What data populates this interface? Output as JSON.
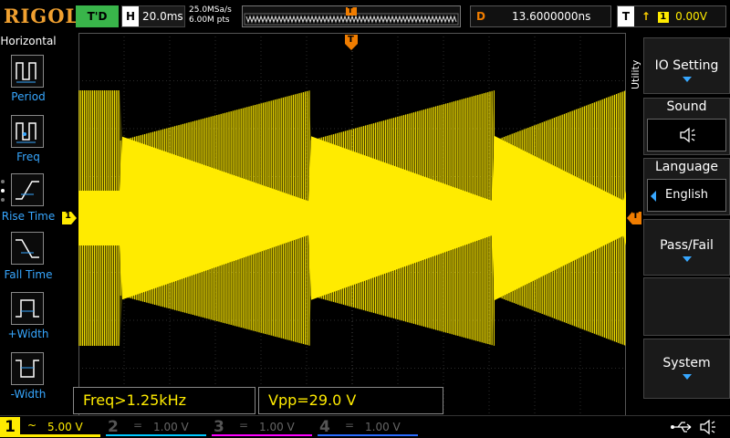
{
  "header": {
    "brand": "RIGOL",
    "run_status": "T'D",
    "horizontal": {
      "label": "H",
      "value": "20.0ms"
    },
    "sample_rate": "25.0MSa/s",
    "memory_depth": "6.00M pts",
    "delay": {
      "label": "D",
      "value": "13.6000000ns"
    },
    "trigger": {
      "label": "T",
      "source": "1",
      "level": "0.00V"
    },
    "memory_marker": "T"
  },
  "left_panel": {
    "title": "Horizontal",
    "items": [
      {
        "label": "Period"
      },
      {
        "label": "Freq"
      },
      {
        "label": "Rise Time"
      },
      {
        "label": "Fall Time"
      },
      {
        "label": "+Width"
      },
      {
        "label": "-Width"
      }
    ]
  },
  "right_panel": {
    "title": "Utility",
    "items": [
      {
        "label": "IO Setting"
      },
      {
        "label": "Sound"
      },
      {
        "label": "Language",
        "value": "English"
      },
      {
        "label": "Pass/Fail"
      },
      {
        "label": "System"
      }
    ]
  },
  "markers": {
    "trigger_top": "T",
    "ch1_ground": "1",
    "trigger_level": "T"
  },
  "measurements": [
    {
      "text": "Freq>1.25kHz"
    },
    {
      "text": "Vpp=29.0 V"
    }
  ],
  "channels": [
    {
      "number": "1",
      "coupling": "~",
      "scale": "5.00 V",
      "color": "#ffeb00",
      "active": true
    },
    {
      "number": "2",
      "coupling": "=",
      "scale": "1.00 V",
      "color": "#00c8ff",
      "active": false
    },
    {
      "number": "3",
      "coupling": "=",
      "scale": "1.00 V",
      "color": "#ff00ff",
      "active": false
    },
    {
      "number": "4",
      "coupling": "=",
      "scale": "1.00 V",
      "color": "#2a6cff",
      "active": false
    }
  ],
  "colors": {
    "ch1": "#ffeb00",
    "accent": "#37a7ff",
    "trigger": "#f07d00",
    "run_status_bg": "#39b54a",
    "brand": "#f0a030"
  }
}
